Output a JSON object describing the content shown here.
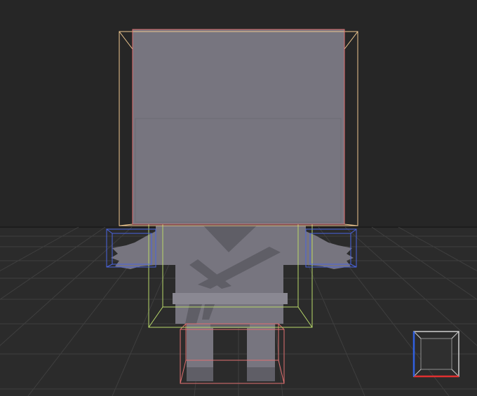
{
  "viewport": {
    "background_color": "#262626",
    "floor_color": "#2b2b2b",
    "grid_line_color": "#3f3f3f",
    "horizon_line_color": "#1d1d1d"
  },
  "model": {
    "body_color": "#77757f",
    "body_shadow_color": "#5f5e66",
    "body_highlight_color": "#8a8892"
  },
  "bounding_boxes": {
    "head_color": "#f0c890",
    "head_front_color": "#e07070",
    "torso_color": "#b8d86a",
    "arms_color": "#4a64e0",
    "legs_color": "#e07070"
  },
  "orientation_gizmo": {
    "icon": "view-cube-icon",
    "edge_color": "#cfcfcf",
    "x_axis_color": "#e03030",
    "z_axis_color": "#3060e0"
  }
}
